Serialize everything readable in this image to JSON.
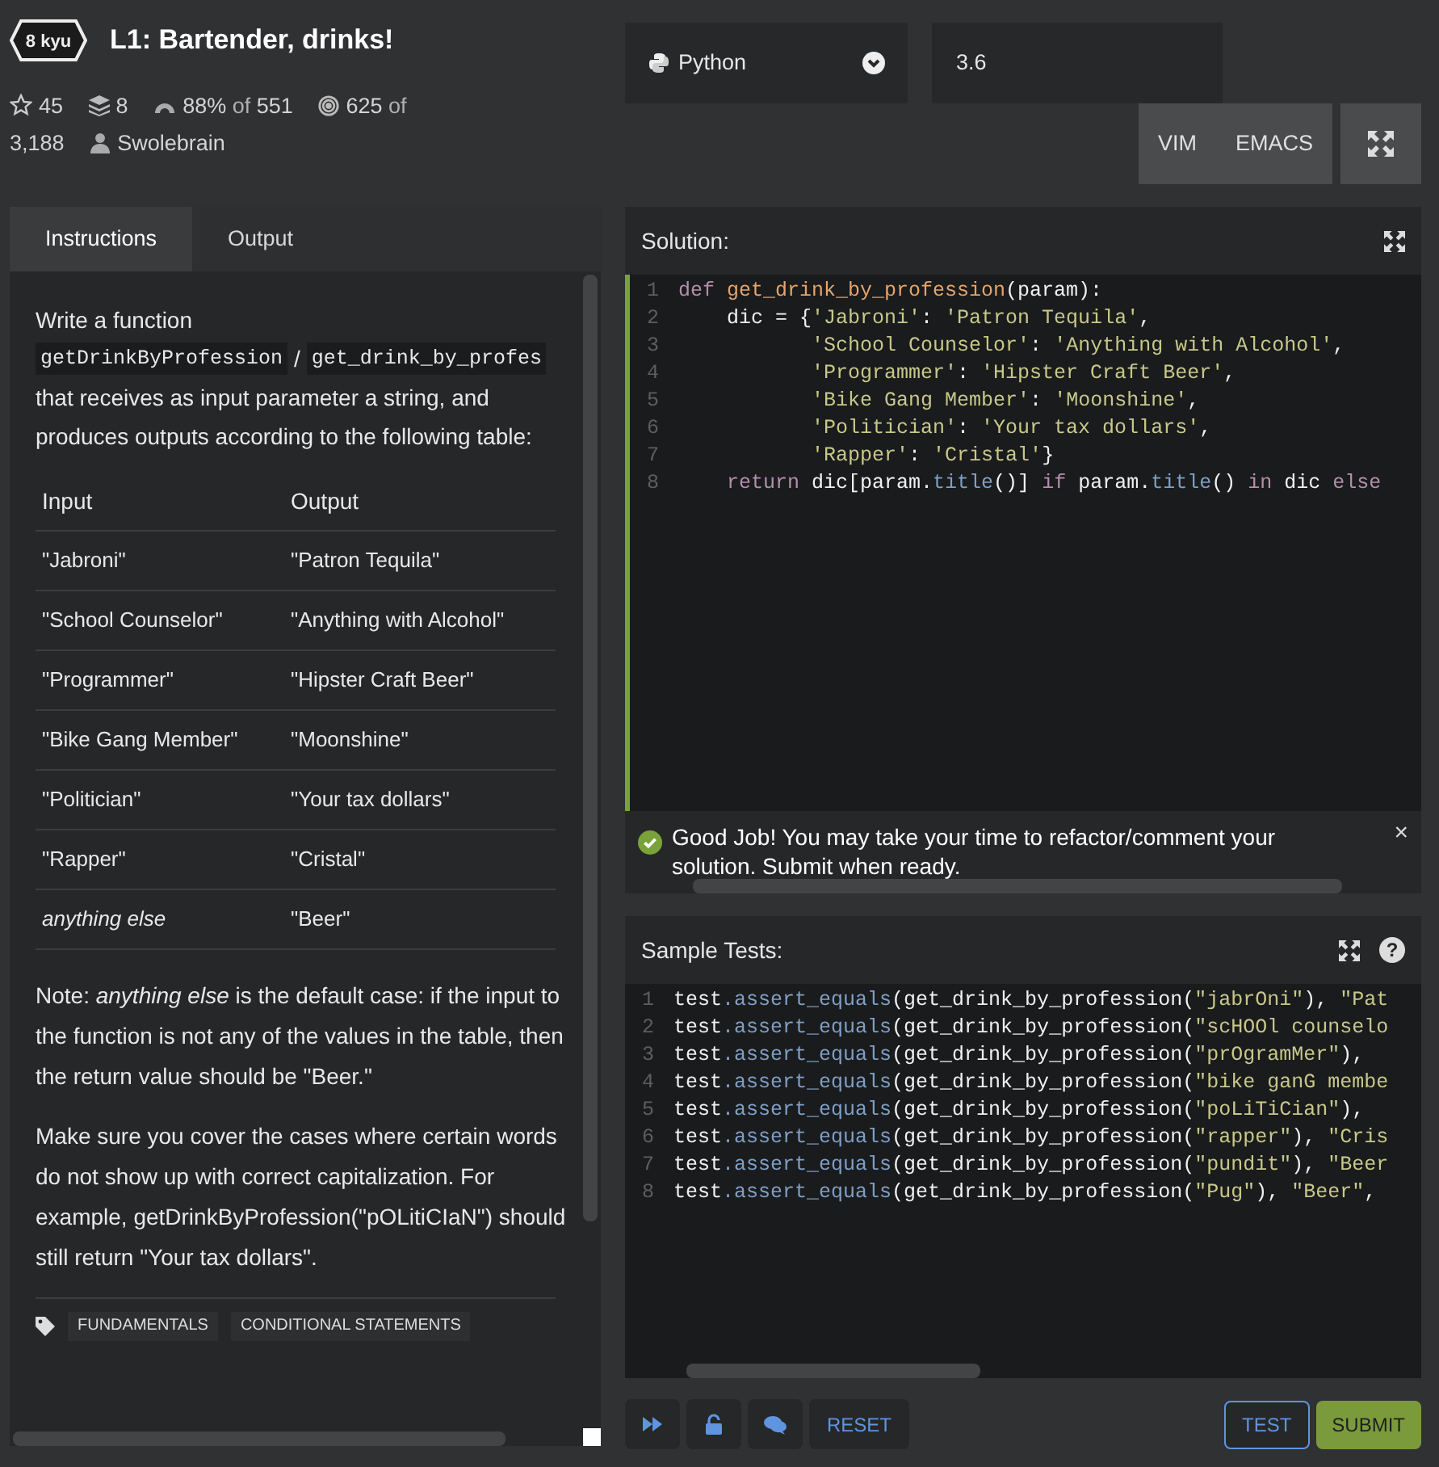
{
  "kata": {
    "rank": "8 kyu",
    "title": "L1: Bartender, drinks!"
  },
  "stats": [
    {
      "kind": "star",
      "value": "45"
    },
    {
      "kind": "collections",
      "value": "8"
    },
    {
      "kind": "gauge",
      "value": "88%",
      "of_label": "of",
      "total": "551"
    },
    {
      "kind": "target",
      "value": "625",
      "of_label": "of",
      "total": "3,188"
    },
    {
      "kind": "author",
      "value": "Swolebrain"
    }
  ],
  "editor_settings": {
    "language": "Python",
    "version": "3.6",
    "modes": [
      {
        "label": "VIM",
        "selected": false
      },
      {
        "label": "EMACS",
        "selected": false
      }
    ]
  },
  "tabs": [
    {
      "label": "Instructions",
      "selected": true
    },
    {
      "label": "Output",
      "selected": false
    }
  ],
  "intro": {
    "lead": "Write a function",
    "names": [
      "getDrinkByProfession",
      "get_drink_by_profes"
    ],
    "separator": "/",
    "rest": "that receives as input parameter a string, and produces outputs according to the following table:"
  },
  "table": {
    "columns": [
      "Input",
      "Output"
    ],
    "rows": [
      [
        "\"Jabroni\"",
        "\"Patron Tequila\""
      ],
      [
        "\"School Counselor\"",
        "\"Anything with Alcohol\""
      ],
      [
        "\"Programmer\"",
        "\"Hipster Craft Beer\""
      ],
      [
        "\"Bike Gang Member\"",
        "\"Moonshine\""
      ],
      [
        "\"Politician\"",
        "\"Your tax dollars\""
      ],
      [
        "\"Rapper\"",
        "\"Cristal\""
      ],
      [
        "*anything else*",
        "\"Beer\""
      ]
    ]
  },
  "paragraphs": [
    "Note: *anything else* is the default case: if the input to the function is not any of the values in the table, then the return value should be \"Beer.\"",
    "Make sure you cover the cases where certain words do not show up with correct capitalization. For example, getDrinkByProfession(\"pOLitiCIaN\") should still return \"Your tax dollars\"."
  ],
  "tags": [
    "FUNDAMENTALS",
    "CONDITIONAL STATEMENTS"
  ],
  "solution": {
    "title": "Solution:",
    "passed": true,
    "lines": [
      {
        "n": "1",
        "tokens": [
          {
            "kind": "keyword",
            "t": "def "
          },
          {
            "kind": "function",
            "t": "get_drink_by_profession"
          },
          {
            "kind": "plain",
            "t": "(param):"
          }
        ]
      },
      {
        "n": "2",
        "tokens": [
          {
            "kind": "plain",
            "t": "    dic = {"
          },
          {
            "kind": "string",
            "t": "'Jabroni'"
          },
          {
            "kind": "plain",
            "t": ": "
          },
          {
            "kind": "string",
            "t": "'Patron Tequila'"
          },
          {
            "kind": "plain",
            "t": ","
          }
        ]
      },
      {
        "n": "3",
        "tokens": [
          {
            "kind": "string",
            "t": "           'School Counselor'"
          },
          {
            "kind": "plain",
            "t": ": "
          },
          {
            "kind": "string",
            "t": "'Anything with Alcohol'"
          },
          {
            "kind": "plain",
            "t": ","
          }
        ]
      },
      {
        "n": "4",
        "tokens": [
          {
            "kind": "string",
            "t": "           'Programmer'"
          },
          {
            "kind": "plain",
            "t": ": "
          },
          {
            "kind": "string",
            "t": "'Hipster Craft Beer'"
          },
          {
            "kind": "plain",
            "t": ","
          }
        ]
      },
      {
        "n": "5",
        "tokens": [
          {
            "kind": "string",
            "t": "           'Bike Gang Member'"
          },
          {
            "kind": "plain",
            "t": ": "
          },
          {
            "kind": "string",
            "t": "'Moonshine'"
          },
          {
            "kind": "plain",
            "t": ","
          }
        ]
      },
      {
        "n": "6",
        "tokens": [
          {
            "kind": "string",
            "t": "           'Politician'"
          },
          {
            "kind": "plain",
            "t": ": "
          },
          {
            "kind": "string",
            "t": "'Your tax dollars'"
          },
          {
            "kind": "plain",
            "t": ","
          }
        ]
      },
      {
        "n": "7",
        "tokens": [
          {
            "kind": "string",
            "t": "           'Rapper'"
          },
          {
            "kind": "plain",
            "t": ": "
          },
          {
            "kind": "string",
            "t": "'Cristal'"
          },
          {
            "kind": "plain",
            "t": "}"
          }
        ]
      },
      {
        "n": "8",
        "tokens": [
          {
            "kind": "keyword",
            "t": "    return "
          },
          {
            "kind": "plain",
            "t": "dic[param."
          },
          {
            "kind": "method",
            "t": "title"
          },
          {
            "kind": "plain",
            "t": "()] "
          },
          {
            "kind": "keyword",
            "t": "if "
          },
          {
            "kind": "plain",
            "t": "param."
          },
          {
            "kind": "method",
            "t": "title"
          },
          {
            "kind": "plain",
            "t": "() "
          },
          {
            "kind": "keyword",
            "t": "in "
          },
          {
            "kind": "plain",
            "t": "dic "
          },
          {
            "kind": "keyword",
            "t": "else"
          }
        ]
      }
    ]
  },
  "notice": {
    "text": "Good Job! You may take your time to refactor/comment your solution. Submit when ready.",
    "close": "×"
  },
  "sample_tests": {
    "title": "Sample Tests:",
    "help": "?",
    "lines": [
      {
        "n": "1",
        "tokens": [
          {
            "kind": "plain",
            "t": "test"
          },
          {
            "kind": "method",
            "t": ".assert_equals"
          },
          {
            "kind": "plain",
            "t": "(get_drink_by_profession("
          },
          {
            "kind": "string",
            "t": "\"jabrOni\""
          },
          {
            "kind": "plain",
            "t": "), "
          },
          {
            "kind": "string",
            "t": "\"Pat"
          }
        ]
      },
      {
        "n": "2",
        "tokens": [
          {
            "kind": "plain",
            "t": "test"
          },
          {
            "kind": "method",
            "t": ".assert_equals"
          },
          {
            "kind": "plain",
            "t": "(get_drink_by_profession("
          },
          {
            "kind": "string",
            "t": "\"scHOOl counselo"
          }
        ]
      },
      {
        "n": "3",
        "tokens": [
          {
            "kind": "plain",
            "t": "test"
          },
          {
            "kind": "method",
            "t": ".assert_equals"
          },
          {
            "kind": "plain",
            "t": "(get_drink_by_profession("
          },
          {
            "kind": "string",
            "t": "\"prOgramMer\""
          },
          {
            "kind": "plain",
            "t": "),"
          }
        ]
      },
      {
        "n": "4",
        "tokens": [
          {
            "kind": "plain",
            "t": "test"
          },
          {
            "kind": "method",
            "t": ".assert_equals"
          },
          {
            "kind": "plain",
            "t": "(get_drink_by_profession("
          },
          {
            "kind": "string",
            "t": "\"bike ganG membe"
          }
        ]
      },
      {
        "n": "5",
        "tokens": [
          {
            "kind": "plain",
            "t": "test"
          },
          {
            "kind": "method",
            "t": ".assert_equals"
          },
          {
            "kind": "plain",
            "t": "(get_drink_by_profession("
          },
          {
            "kind": "string",
            "t": "\"poLiTiCian\""
          },
          {
            "kind": "plain",
            "t": "),"
          }
        ]
      },
      {
        "n": "6",
        "tokens": [
          {
            "kind": "plain",
            "t": "test"
          },
          {
            "kind": "method",
            "t": ".assert_equals"
          },
          {
            "kind": "plain",
            "t": "(get_drink_by_profession("
          },
          {
            "kind": "string",
            "t": "\"rapper\""
          },
          {
            "kind": "plain",
            "t": "), "
          },
          {
            "kind": "string",
            "t": "\"Cris"
          }
        ]
      },
      {
        "n": "7",
        "tokens": [
          {
            "kind": "plain",
            "t": "test"
          },
          {
            "kind": "method",
            "t": ".assert_equals"
          },
          {
            "kind": "plain",
            "t": "(get_drink_by_profession("
          },
          {
            "kind": "string",
            "t": "\"pundit\""
          },
          {
            "kind": "plain",
            "t": "), "
          },
          {
            "kind": "string",
            "t": "\"Beer"
          }
        ]
      },
      {
        "n": "8",
        "tokens": [
          {
            "kind": "plain",
            "t": "test"
          },
          {
            "kind": "method",
            "t": ".assert_equals"
          },
          {
            "kind": "plain",
            "t": "(get_drink_by_profession("
          },
          {
            "kind": "string",
            "t": "\"Pug\""
          },
          {
            "kind": "plain",
            "t": "), "
          },
          {
            "kind": "string",
            "t": "\"Beer\""
          },
          {
            "kind": "plain",
            "t": ","
          }
        ]
      }
    ]
  },
  "actions": [
    {
      "kind": "icon"
    },
    {
      "kind": "icon"
    },
    {
      "kind": "icon"
    },
    {
      "kind": "text",
      "label": "RESET"
    }
  ],
  "run_buttons": [
    {
      "kind": "outline",
      "label": "TEST"
    },
    {
      "kind": "primary",
      "label": "SUBMIT"
    }
  ]
}
